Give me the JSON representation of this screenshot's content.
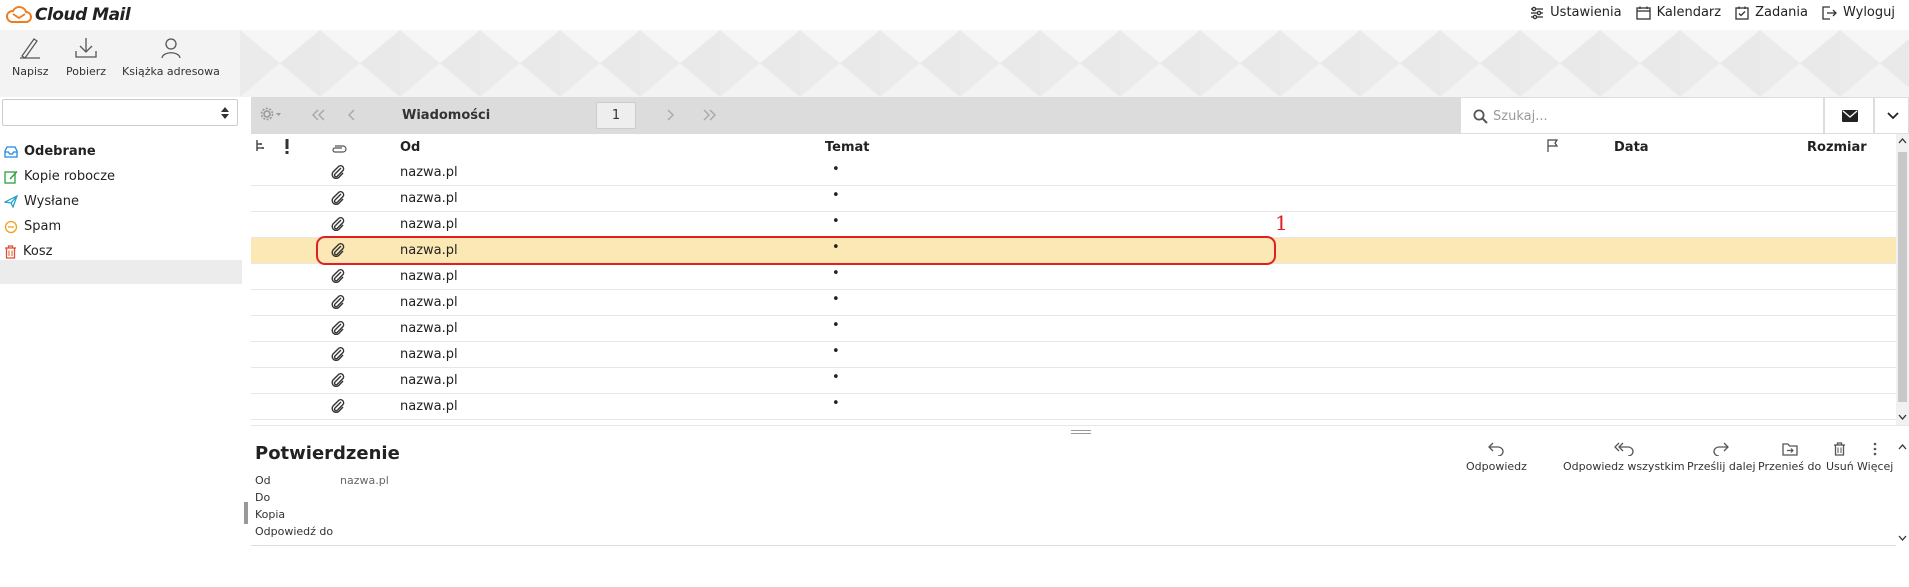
{
  "app": {
    "logo_text": "Cloud Mail"
  },
  "topnav": {
    "items": [
      {
        "label": "Ustawienia",
        "icon": "sliders-icon"
      },
      {
        "label": "Kalendarz",
        "icon": "calendar-icon"
      },
      {
        "label": "Zadania",
        "icon": "tasks-icon"
      },
      {
        "label": "Wyloguj",
        "icon": "logout-icon"
      }
    ]
  },
  "toolbar": {
    "compose_label": "Napisz",
    "download_label": "Pobierz",
    "addressbook_label": "Książka adresowa"
  },
  "sidebar": {
    "account_value": "",
    "folders": [
      {
        "label": "Odebrane",
        "icon": "inbox-icon",
        "active": true
      },
      {
        "label": "Kopie robocze",
        "icon": "drafts-icon"
      },
      {
        "label": "Wysłane",
        "icon": "sent-icon"
      },
      {
        "label": "Spam",
        "icon": "spam-icon"
      },
      {
        "label": "Kosz",
        "icon": "trash-icon"
      }
    ]
  },
  "listbar": {
    "title": "Wiadomości",
    "page": "1",
    "search_placeholder": "Szukaj..."
  },
  "table": {
    "columns": {
      "from": "Od",
      "subject": "Temat",
      "date": "Data",
      "size": "Rozmiar"
    },
    "rows": [
      {
        "from": "nazwa.pl",
        "subject": "•"
      },
      {
        "from": "nazwa.pl",
        "subject": "•"
      },
      {
        "from": "nazwa.pl",
        "subject": "•"
      },
      {
        "from": "nazwa.pl",
        "subject": "•",
        "selected": true
      },
      {
        "from": "nazwa.pl",
        "subject": "•"
      },
      {
        "from": "nazwa.pl",
        "subject": "•"
      },
      {
        "from": "nazwa.pl",
        "subject": "•"
      },
      {
        "from": "nazwa.pl",
        "subject": "•"
      },
      {
        "from": "nazwa.pl",
        "subject": "•"
      },
      {
        "from": "nazwa.pl",
        "subject": "•"
      }
    ]
  },
  "annotation": {
    "label": "1"
  },
  "preview": {
    "subject": "Potwierdzenie",
    "fields": [
      {
        "key": "Od",
        "value": "nazwa.pl"
      },
      {
        "key": "Do",
        "value": ""
      },
      {
        "key": "Kopia",
        "value": ""
      },
      {
        "key": "Odpowiedź do",
        "value": ""
      }
    ],
    "actions": {
      "reply": "Odpowiedz",
      "reply_all": "Odpowiedz wszystkim",
      "forward": "Prześlij dalej",
      "move": "Przenieś do",
      "delete": "Usuń",
      "more": "Więcej"
    }
  },
  "colors": {
    "selected_row": "#fbe8b4",
    "annotation": "#e02020",
    "logo_accent": "#f07c20"
  }
}
